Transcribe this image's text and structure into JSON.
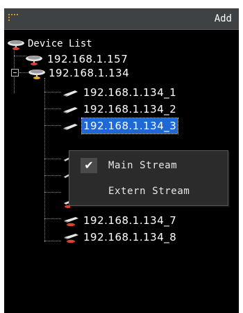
{
  "header": {
    "add_label": "Add",
    "grip_icon": "grip-dots-icon"
  },
  "tree": {
    "root_label": "Device List",
    "devices": [
      {
        "label": "192.168.1.157"
      },
      {
        "label": "192.168.1.134"
      }
    ],
    "channels": [
      {
        "label": "192.168.1.134_1",
        "icon": "camera-icon"
      },
      {
        "label": "192.168.1.134_2",
        "icon": "camera-icon"
      },
      {
        "label": "192.168.1.134_3",
        "icon": "camera-icon",
        "selected": true
      },
      {
        "label": "192.168.1.134_7",
        "icon": "camera-offline-icon"
      },
      {
        "label": "192.168.1.134_8",
        "icon": "camera-offline-icon"
      }
    ]
  },
  "context_menu": {
    "items": [
      {
        "label": "Main Stream",
        "checked": true
      },
      {
        "label": "Extern Stream",
        "checked": false
      }
    ],
    "check_glyph": "✔"
  },
  "colors": {
    "panel_bg": "#000000",
    "header_bg": "#3e4244",
    "selection": "#1f69d6",
    "menu_bg": "#2b2b2b"
  }
}
